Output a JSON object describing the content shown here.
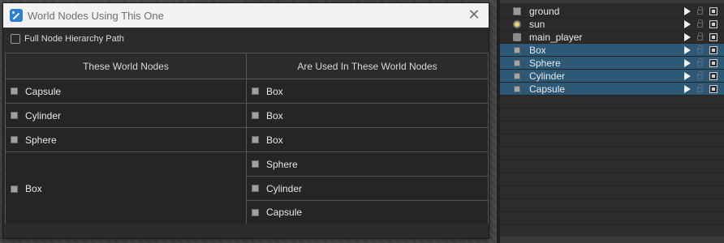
{
  "dialog": {
    "title": "World Nodes Using This One",
    "close_glyph": "✕",
    "option_label": "Full Node Hierarchy Path",
    "option_checked": false
  },
  "table": {
    "headers": [
      "These World Nodes",
      "Are Used In These World Nodes"
    ],
    "left": [
      "Capsule",
      "Cylinder",
      "Sphere",
      "Box"
    ],
    "right": [
      "Box",
      "Box",
      "Box",
      "Sphere",
      "Cylinder",
      "Capsule"
    ],
    "icon": "mesh-node-icon"
  },
  "scene_tree": {
    "items": [
      {
        "label": "ground",
        "icon": "ground-icon",
        "selected": false
      },
      {
        "label": "sun",
        "icon": "sun-icon",
        "selected": false
      },
      {
        "label": "main_player",
        "icon": "player-icon",
        "selected": false
      },
      {
        "label": "Box",
        "icon": "mesh-node-icon",
        "selected": true
      },
      {
        "label": "Sphere",
        "icon": "mesh-node-icon",
        "selected": true
      },
      {
        "label": "Cylinder",
        "icon": "mesh-node-icon",
        "selected": true
      },
      {
        "label": "Capsule",
        "icon": "mesh-node-icon",
        "selected": true
      }
    ],
    "selection_color": "#2d5876"
  }
}
